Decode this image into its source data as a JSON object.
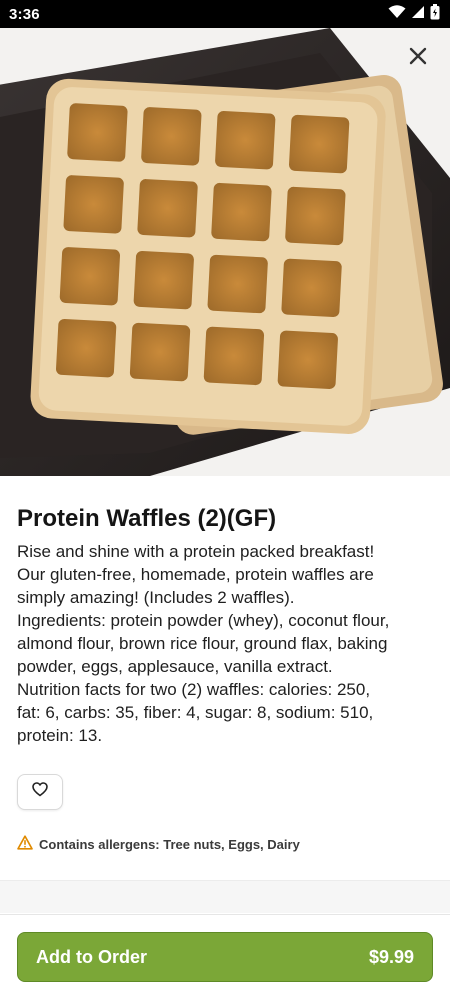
{
  "status_bar": {
    "time": "3:36"
  },
  "item": {
    "title": "Protein Waffles (2)(GF)",
    "description": "Rise and shine with a protein packed breakfast!\nOur gluten-free,  homemade, protein waffles are\nsimply amazing! (Includes 2 waffles).\nIngredients: protein powder (whey), coconut flour,\nalmond flour, brown rice flour, ground flax, baking\npowder, eggs, applesauce, vanilla extract.\nNutrition facts for two (2) waffles: calories: 250,\nfat: 6, carbs: 35, fiber: 4, sugar: 8, sodium: 510,\nprotein: 13.",
    "allergens": "Contains allergens: Tree nuts, Eggs, Dairy"
  },
  "order_button": {
    "label": "Add to Order",
    "price": "$9.99"
  },
  "icons": {
    "close": "close-icon",
    "favorite": "heart-icon",
    "warning": "warning-icon",
    "wifi": "wifi-icon",
    "signal": "signal-icon",
    "battery": "battery-icon"
  },
  "colors": {
    "accent": "#7ba737",
    "warning": "#e08a00"
  }
}
